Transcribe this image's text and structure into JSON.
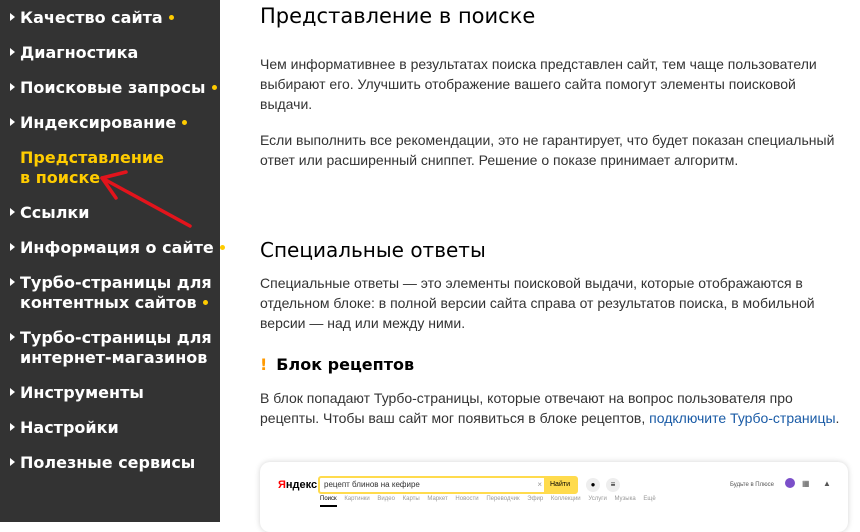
{
  "sidebar": {
    "items": [
      {
        "label": "Качество сайта",
        "dot": true
      },
      {
        "label": "Диагностика",
        "dot": false
      },
      {
        "label": "Поисковые запросы",
        "dot": true
      },
      {
        "label": "Индексирование",
        "dot": true
      },
      {
        "label_line1": "Представление",
        "label_line2": "в поиске",
        "active": true
      },
      {
        "label": "Ссылки",
        "dot": false
      },
      {
        "label": "Информация о сайте",
        "dot": true
      },
      {
        "label_line1": "Турбо-страницы для",
        "label_line2": "контентных сайтов",
        "dot": true
      },
      {
        "label_line1": "Турбо-страницы для",
        "label_line2": "интернет-магазинов",
        "dot": false
      },
      {
        "label": "Инструменты",
        "dot": false
      },
      {
        "label": "Настройки",
        "dot": false
      },
      {
        "label": "Полезные сервисы",
        "dot": false
      }
    ]
  },
  "main": {
    "title": "Представление в поиске",
    "intro1": "Чем информативнее в результатах поиска представлен сайт, тем чаще пользователи выбирают его. Улучшить отображение вашего сайта помогут элементы поисковой выдачи.",
    "intro2": "Если выполнить все рекомендации, это не гарантирует, что будет показан специальный ответ или расширенный сниппет. Решение о показе принимает алгоритм.",
    "section_title": "Специальные ответы",
    "section_text": "Специальные ответы — это элементы поисковой выдачи, которые отображаются в отдельном блоке: в полной версии сайта справа от результатов поиска, в мобильной версии — над или между ними.",
    "subsection_mark": "!",
    "subsection_title": "Блок рецептов",
    "recipe_text": "В блок попадают Турбо-страницы, которые отвечают на вопрос пользователя про рецепты. Чтобы ваш сайт мог появиться в блоке рецептов, ",
    "recipe_link": "подключите Турбо-страницы",
    "recipe_end": "."
  },
  "screenshot": {
    "logo_first": "Я",
    "logo_rest": "ндекс",
    "query": "рецепт блинов на кефире",
    "clear": "×",
    "search_button": "Найти",
    "tabs": [
      "Поиск",
      "Картинки",
      "Видео",
      "Карты",
      "Маркет",
      "Новости",
      "Переводчик",
      "Эфир",
      "Коллекции",
      "Услуги",
      "Музыка",
      "Ещё"
    ],
    "right_text": "Будьте в Плюсе"
  },
  "colors": {
    "sidebar_bg": "#333333",
    "active": "#ffcc00",
    "link": "#1a5ba6",
    "warn": "#ff9900",
    "arrow": "#e3141c"
  }
}
